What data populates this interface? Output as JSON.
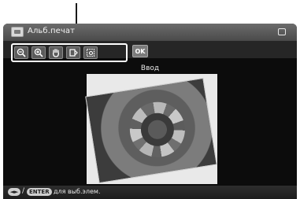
{
  "window": {
    "title": "Альб.печат",
    "app_icon": "album-icon",
    "corner_icon": "window-icon"
  },
  "toolbar": {
    "tools": [
      {
        "name": "zoom-out-icon",
        "glyph": "⊖"
      },
      {
        "name": "zoom-in-icon",
        "glyph": "⊕"
      },
      {
        "name": "hand-pan-icon",
        "glyph": "✋"
      },
      {
        "name": "rotate-icon",
        "glyph": "⤾"
      },
      {
        "name": "trim-icon",
        "glyph": "⬚"
      }
    ],
    "ok_label": "OK"
  },
  "main": {
    "section_label": "Ввод"
  },
  "hint": {
    "arrows_label": "◄►",
    "slash": "/",
    "enter_label": "ENTER",
    "text": "для выб.элем."
  },
  "colors": {
    "screen_bg": "#0c0c0c",
    "titlebar": "#5a5a5a",
    "highlight": "#ffffff"
  }
}
